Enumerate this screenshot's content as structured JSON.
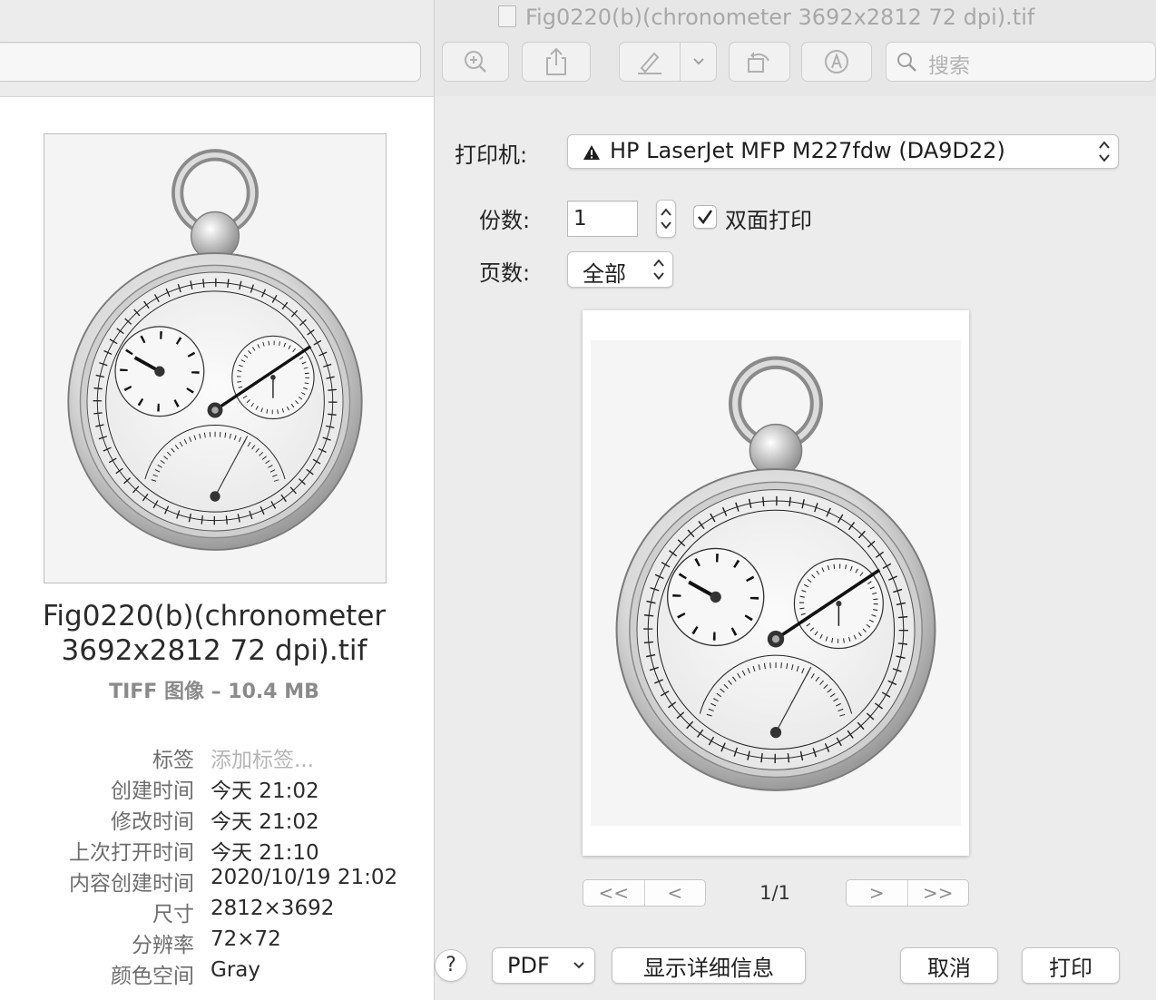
{
  "finder": {
    "file_name": "Fig0220(b)(chronometer 3692x2812  72 dpi).tif",
    "file_kind": "TIFF 图像 – 10.4 MB",
    "meta": [
      {
        "key": "标签",
        "value": "添加标签..."
      },
      {
        "key": "创建时间",
        "value": "今天 21:02"
      },
      {
        "key": "修改时间",
        "value": "今天 21:02"
      },
      {
        "key": "上次打开时间",
        "value": "今天 21:10"
      },
      {
        "key": "内容创建时间",
        "value": "2020/10/19 21:02"
      },
      {
        "key": "尺寸",
        "value": "2812×3692"
      },
      {
        "key": "分辨率",
        "value": "72×72"
      },
      {
        "key": "颜色空间",
        "value": "Gray"
      }
    ],
    "thumbnail_icon": "chronometer-image"
  },
  "window": {
    "title": "Fig0220(b)(chronometer 3692x2812  72 dpi).tif",
    "toolbar": [
      "zoom-in-icon",
      "share-icon",
      "markup-pen-icon",
      "chevron-down-icon",
      "rotate-icon",
      "annotate-icon"
    ],
    "search_placeholder": "搜索"
  },
  "print": {
    "printer_label": "打印机:",
    "printer_value": "HP LaserJet MFP M227fdw (DA9D22)",
    "copies_label": "份数:",
    "copies_value": "1",
    "duplex_label": "双面打印",
    "duplex_checked": true,
    "pages_label": "页数:",
    "pages_value": "全部",
    "page_indicator": "1/1",
    "pager": {
      "first": "<<",
      "prev": "<",
      "next": ">",
      "last": ">>"
    },
    "help_label": "?",
    "pdf_label": "PDF",
    "details_label": "显示详细信息",
    "cancel_label": "取消",
    "print_label": "打印"
  }
}
